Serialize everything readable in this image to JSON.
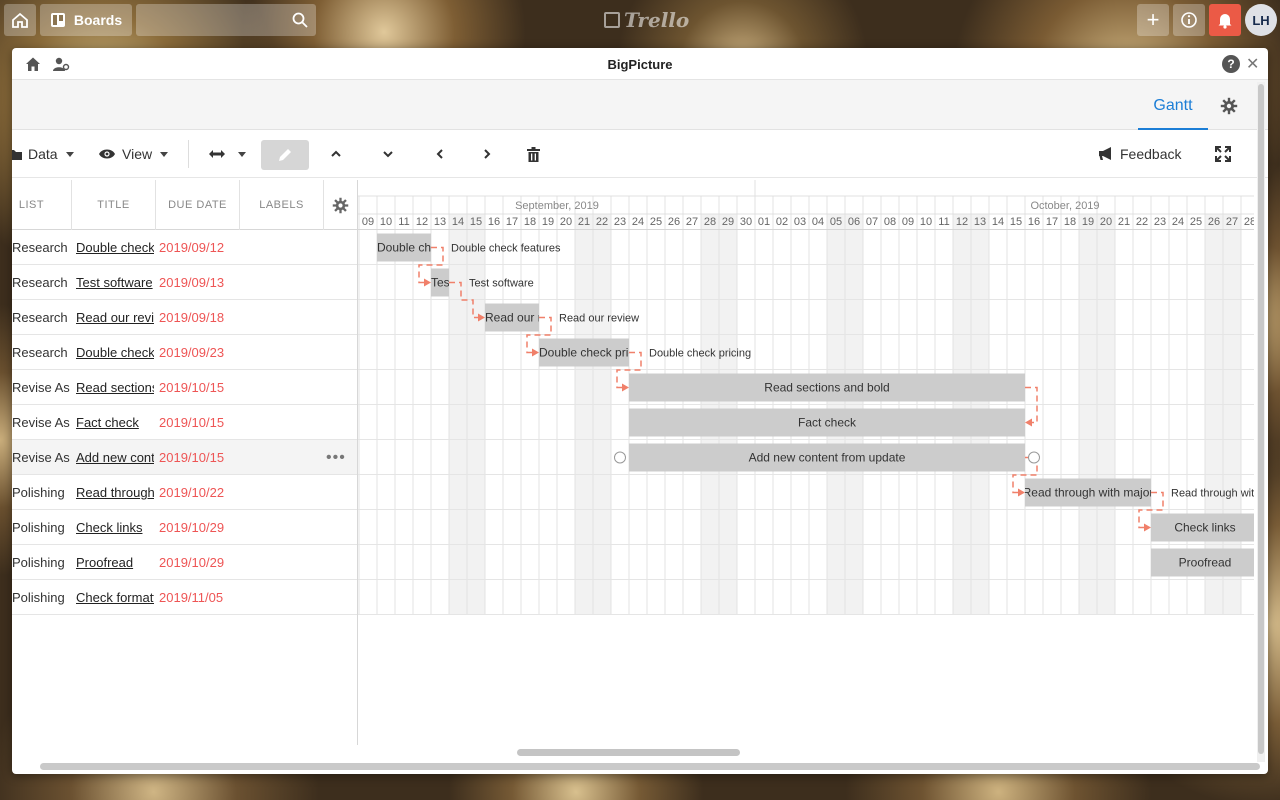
{
  "topbar": {
    "boards_label": "Boards",
    "logo_text": "Trello",
    "avatar_initials": "LH"
  },
  "window": {
    "title": "BigPicture",
    "help_label": "?",
    "close_label": "✕"
  },
  "tabs": {
    "gantt": "Gantt"
  },
  "toolbar": {
    "data_label": "Data",
    "view_label": "View",
    "feedback_label": "Feedback"
  },
  "grid": {
    "headers": {
      "list": "LIST",
      "title": "TITLE",
      "due": "DUE DATE",
      "labels": "LABELS"
    },
    "rows": [
      {
        "list": "Research",
        "title": "Double check features",
        "due": "2019/09/12"
      },
      {
        "list": "Research",
        "title": "Test software",
        "due": "2019/09/13"
      },
      {
        "list": "Research",
        "title": "Read our review",
        "due": "2019/09/18"
      },
      {
        "list": "Research",
        "title": "Double check pricing",
        "due": "2019/09/23"
      },
      {
        "list": "Revise Assignment",
        "title": "Read sections and bold",
        "due": "2019/10/15"
      },
      {
        "list": "Revise Assignment",
        "title": "Fact check",
        "due": "2019/10/15"
      },
      {
        "list": "Revise Assignment",
        "title": "Add new content from update",
        "due": "2019/10/15"
      },
      {
        "list": "Polishing",
        "title": "Read through with major",
        "due": "2019/10/22"
      },
      {
        "list": "Polishing",
        "title": "Check links",
        "due": "2019/10/29"
      },
      {
        "list": "Polishing",
        "title": "Proofread",
        "due": "2019/10/29"
      },
      {
        "list": "Polishing",
        "title": "Check formatting",
        "due": "2019/11/05"
      }
    ],
    "more_label": "•••"
  },
  "timeline": {
    "months": [
      "September, 2019",
      "October, 2019"
    ],
    "days": [
      "09",
      "10",
      "11",
      "12",
      "13",
      "14",
      "15",
      "16",
      "17",
      "18",
      "19",
      "20",
      "21",
      "22",
      "23",
      "24",
      "25",
      "26",
      "27",
      "28",
      "29",
      "30",
      "01",
      "02",
      "03",
      "04",
      "05",
      "06",
      "07",
      "08",
      "09",
      "10",
      "11",
      "12",
      "13",
      "14",
      "15",
      "16",
      "17",
      "18",
      "19",
      "20",
      "21",
      "22",
      "23",
      "24",
      "25",
      "26",
      "27",
      "28"
    ],
    "weekend_index": [
      5,
      6,
      12,
      13,
      19,
      20,
      26,
      27,
      33,
      34,
      40,
      41,
      47,
      48
    ],
    "bars": [
      {
        "row": 0,
        "start": 1,
        "len": 3,
        "text": "Double check features",
        "outside": "Double check features"
      },
      {
        "row": 1,
        "start": 4,
        "len": 1,
        "text": "Test software",
        "outside": "Test software"
      },
      {
        "row": 2,
        "start": 7,
        "len": 3,
        "text": "Read our review",
        "outside": "Read our review"
      },
      {
        "row": 3,
        "start": 10,
        "len": 5,
        "text": "Double check pricing",
        "outside": "Double check pricing"
      },
      {
        "row": 4,
        "start": 15,
        "len": 22,
        "text": "Read sections and bold",
        "outside": ""
      },
      {
        "row": 5,
        "start": 15,
        "len": 22,
        "text": "Fact check",
        "outside": ""
      },
      {
        "row": 6,
        "start": 15,
        "len": 22,
        "text": "Add new content from update",
        "outside": ""
      },
      {
        "row": 7,
        "start": 37,
        "len": 7,
        "text": "Read through with major",
        "outside": "Read through with major"
      },
      {
        "row": 8,
        "start": 44,
        "len": 6,
        "text": "Check links",
        "outside": ""
      },
      {
        "row": 9,
        "start": 44,
        "len": 6,
        "text": "Proofread",
        "outside": ""
      }
    ],
    "colors": {
      "bar": "#cccccc",
      "link": "#f0806a",
      "weekend": "#f2f2f2"
    }
  }
}
